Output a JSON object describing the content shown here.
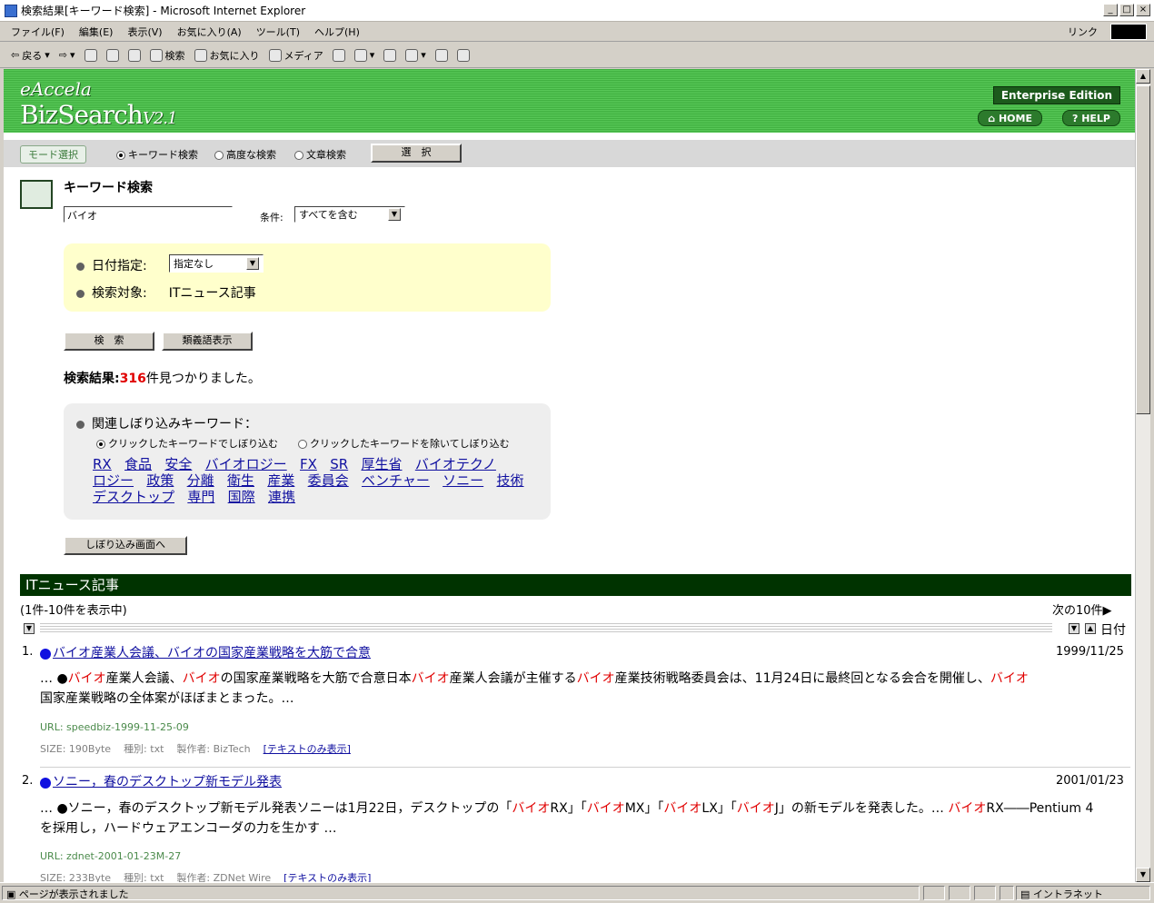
{
  "window": {
    "title": "検索結果[キーワード検索] - Microsoft Internet Explorer",
    "controls": [
      "_",
      "□",
      "×"
    ]
  },
  "menu": [
    "ファイル(F)",
    "編集(E)",
    "表示(V)",
    "お気に入り(A)",
    "ツール(T)",
    "ヘルプ(H)"
  ],
  "links_label": "リンク",
  "toolbar": {
    "back": "戻る",
    "search": "検索",
    "favorites": "お気に入り",
    "media": "メディア"
  },
  "header": {
    "logo_top": "eAccela",
    "logo_main": "BizSearch",
    "logo_version": "V2.1",
    "edition": "Enterprise Edition",
    "home": "HOME",
    "help": "HELP"
  },
  "mode": {
    "label": "モード選択",
    "options": [
      "キーワード検索",
      "高度な検索",
      "文章検索"
    ],
    "selected": "キーワード検索",
    "select_button": "選　択"
  },
  "search": {
    "title": "キーワード検索",
    "query": "バイオ",
    "condition_label": "条件:",
    "condition_value": "すべてを含む",
    "date_label": "日付指定:",
    "date_value": "指定なし",
    "target_label": "検索対象:",
    "target_value": "ITニュース記事",
    "search_button": "検　索",
    "synonym_button": "類義語表示"
  },
  "result_summary": {
    "prefix": "検索結果:",
    "count": "316",
    "suffix": "件見つかりました。"
  },
  "refine": {
    "title": "関連しぼり込みキーワード：",
    "option_include": "クリックしたキーワードでしぼり込む",
    "option_exclude": "クリックしたキーワードを除いてしぼり込む",
    "keywords_row1": [
      "RX",
      "食品",
      "安全",
      "バイオロジー",
      "FX",
      "SR",
      "厚生省",
      "バイオテクノ"
    ],
    "keywords_row2": [
      "ロジー",
      "政策",
      "分離",
      "衛生",
      "産業",
      "委員会",
      "ベンチャー",
      "ソニー",
      "技術"
    ],
    "keywords_row3": [
      "デスクトップ",
      "専門",
      "国際",
      "連携"
    ],
    "refine_button": "しぼり込み画面へ"
  },
  "results": {
    "section_title": "ITニュース記事",
    "range": "(1件-10件を表示中)",
    "next": "次の10件▶",
    "sort_label": "日付",
    "items": [
      {
        "num": "1.",
        "title": "バイオ産業人会議、バイオの国家産業戦略を大筋で合意",
        "date": "1999/11/25",
        "url": "URL: speedbiz-1999-11-25-09",
        "size": "SIZE: 190Byte",
        "kind": "種別: txt",
        "author": "製作者: BizTech",
        "textonly": "[テキストのみ表示]"
      },
      {
        "num": "2.",
        "title": "ソニー，春のデスクトップ新モデル発表",
        "date": "2001/01/23",
        "url": "URL: zdnet-2001-01-23M-27",
        "size": "SIZE: 233Byte",
        "kind": "種別: txt",
        "author": "製作者: ZDNet Wire",
        "textonly": "[テキストのみ表示]"
      }
    ],
    "snippet1": [
      "… ●",
      "バイオ",
      "産業人会議、",
      "バイオ",
      "の国家産業戦略を大筋で合意日本",
      "バイオ",
      "産業人会議が主催する",
      "バイオ",
      "産業技術戦略委員会は、11月24日に最終回となる会合を開催し、",
      "バイオ",
      "国家産業戦略の全体案がほぼまとまった。…"
    ],
    "snippet2": [
      "… ●ソニー，春のデスクトップ新モデル発表ソニーは1月22日，デスクトップの「",
      "バイオ",
      "RX」「",
      "バイオ",
      "MX」「",
      "バイオ",
      "LX」「",
      "バイオ",
      "J」の新モデルを発表した。… ",
      "バイオ",
      "RX――Pentium 4",
      "を採用し，ハードウェアエンコーダの力を生かす …"
    ]
  },
  "status": {
    "text": "ページが表示されました",
    "zone": "イントラネット"
  }
}
